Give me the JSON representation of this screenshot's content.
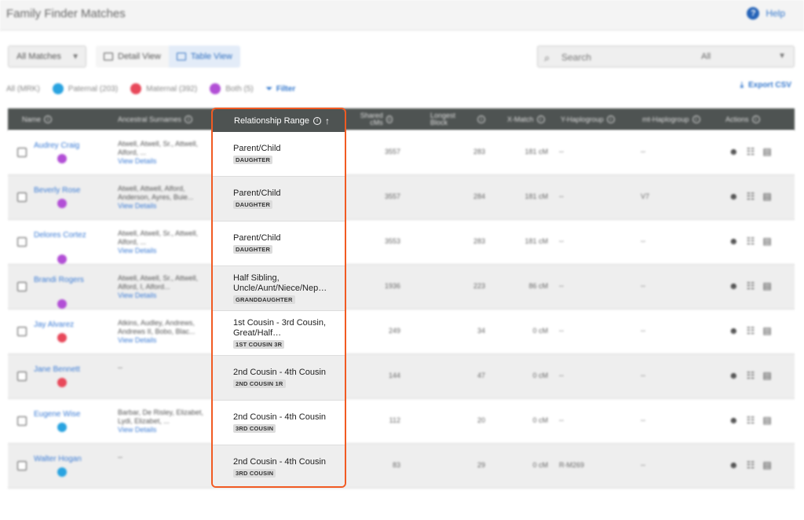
{
  "header": {
    "title": "Family Finder Matches",
    "help_label": "Help"
  },
  "controls": {
    "matches_select": "All Matches",
    "detail_view_label": "Detail View",
    "table_view_label": "Table View",
    "search_placeholder": "Search",
    "search_scope": "All"
  },
  "filters": {
    "all_label": "All (MRK)",
    "paternal_label": "Paternal (203)",
    "maternal_label": "Maternal (392)",
    "both_label": "Both (5)",
    "filter_label": "Filter",
    "export_label": "Export CSV",
    "colors": {
      "paternal": "#29a3e0",
      "maternal": "#e8485a",
      "both": "#b24fd6"
    }
  },
  "table": {
    "columns": {
      "name": "Name",
      "surnames": "Ancestral Surnames",
      "relationship": "Relationship Range",
      "shared_cm": "Shared cMs",
      "longest_block": "Longest Block",
      "x_match": "X-Match",
      "y_haplogroup": "Y-Haplogroup",
      "mt_haplogroup": "mt-Haplogroup",
      "actions": "Actions"
    },
    "rows": [
      {
        "name": "Audrey Craig",
        "side": "both",
        "surnames": "Atwell, Atwell, Sr., Attwell, Alford, ...",
        "view_details": "View Details",
        "relationship": "Parent/Child",
        "badge": "DAUGHTER",
        "shared": "3557",
        "longest": "283",
        "xmatch": "181 cM",
        "y": "--",
        "mt": "--"
      },
      {
        "name": "Beverly Rose",
        "side": "both",
        "surnames": "Atwell, Attwell, Alford, Anderson, Ayres, Buie...",
        "view_details": "View Details",
        "relationship": "Parent/Child",
        "badge": "DAUGHTER",
        "shared": "3557",
        "longest": "284",
        "xmatch": "181 cM",
        "y": "--",
        "mt": "V7"
      },
      {
        "name": "Delores Cortez",
        "side": "both",
        "surnames": "Atwell, Atwell, Sr., Attwell, Alford, ...",
        "view_details": "View Details",
        "relationship": "Parent/Child",
        "badge": "DAUGHTER",
        "shared": "3553",
        "longest": "283",
        "xmatch": "181 cM",
        "y": "--",
        "mt": "--"
      },
      {
        "name": "Brandi Rogers",
        "side": "both",
        "surnames": "Atwell, Atwell, Sr., Attwell, Alford, I, Alford...",
        "view_details": "View Details",
        "relationship": "Half Sibling, Uncle/Aunt/Niece/Nep…",
        "badge": "GRANDDAUGHTER",
        "shared": "1936",
        "longest": "223",
        "xmatch": "86 cM",
        "y": "--",
        "mt": "--"
      },
      {
        "name": "Jay Alvarez",
        "side": "maternal",
        "surnames": "Atkins, Audley, Andrews, Andrews II, Bobo, Blac...",
        "view_details": "View Details",
        "relationship": "1st Cousin - 3rd Cousin, Great/Half…",
        "badge": "1ST COUSIN 3R",
        "shared": "249",
        "longest": "34",
        "xmatch": "0 cM",
        "y": "--",
        "mt": "--"
      },
      {
        "name": "Jane Bennett",
        "side": "maternal",
        "surnames": "--",
        "view_details": "",
        "relationship": "2nd Cousin - 4th Cousin",
        "badge": "2ND COUSIN 1R",
        "shared": "144",
        "longest": "47",
        "xmatch": "0 cM",
        "y": "--",
        "mt": "--"
      },
      {
        "name": "Eugene Wise",
        "side": "paternal",
        "surnames": "Barbar, De Risley, Elizabet, Lydi, Elizabet, ...",
        "view_details": "View Details",
        "relationship": "2nd Cousin - 4th Cousin",
        "badge": "3RD COUSIN",
        "shared": "112",
        "longest": "20",
        "xmatch": "0 cM",
        "y": "--",
        "mt": "--"
      },
      {
        "name": "Walter Hogan",
        "side": "paternal",
        "surnames": "--",
        "view_details": "",
        "relationship": "2nd Cousin - 4th Cousin",
        "badge": "3RD COUSIN",
        "shared": "83",
        "longest": "29",
        "xmatch": "0 cM",
        "y": "R-M269",
        "mt": "--"
      }
    ]
  },
  "icons": {
    "help": "help-circle-icon",
    "search": "search-icon",
    "filter": "filter-icon",
    "export": "download-icon",
    "info": "info-icon",
    "sort": "arrow-up-icon",
    "profile": "profile-icon",
    "tree": "tree-icon",
    "note": "note-icon"
  }
}
